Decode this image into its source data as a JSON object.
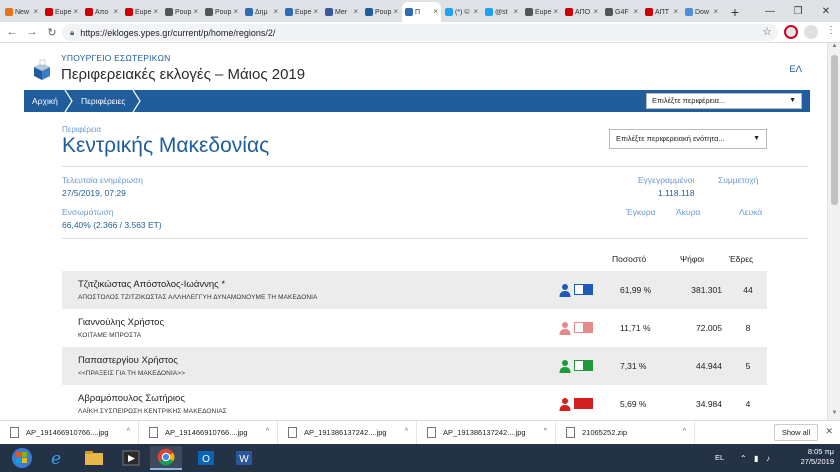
{
  "browser": {
    "tabs": [
      {
        "label": "New",
        "color": "#e8711a",
        "active": false
      },
      {
        "label": "Eupe",
        "color": "#cc0000",
        "active": false
      },
      {
        "label": "Απο",
        "color": "#cc0000",
        "active": false
      },
      {
        "label": "Eupe",
        "color": "#cc0000",
        "active": false
      },
      {
        "label": "Poup",
        "color": "#555555",
        "active": false
      },
      {
        "label": "Poup",
        "color": "#555555",
        "active": false
      },
      {
        "label": "Δημ",
        "color": "#2e6db4",
        "active": false
      },
      {
        "label": "Eupe",
        "color": "#2e6db4",
        "active": false
      },
      {
        "label": "Mer",
        "color": "#3b5998",
        "active": false
      },
      {
        "label": "Poup",
        "color": "#1f5d9c",
        "active": false
      },
      {
        "label": "Π",
        "color": "#2e6db4",
        "active": true
      },
      {
        "label": "(*) ©",
        "color": "#1da1f2",
        "active": false
      },
      {
        "label": "@st",
        "color": "#1da1f2",
        "active": false
      },
      {
        "label": "Eupe",
        "color": "#555555",
        "active": false
      },
      {
        "label": "ΑΠΟ",
        "color": "#cc0000",
        "active": false
      },
      {
        "label": "G4F",
        "color": "#555555",
        "active": false
      },
      {
        "label": "ΑΠΤ",
        "color": "#cc0000",
        "active": false
      },
      {
        "label": "Dow",
        "color": "#4a90d9",
        "active": false
      }
    ],
    "url": "https://ekloges.ypes.gr/current/p/home/regions/2/"
  },
  "site": {
    "ministry": "ΥΠΟΥΡΓΕΙΟ ΕΣΩΤΕΡΙΚΩΝ",
    "title": "Περιφερειακές εκλογές – Μάιος 2019",
    "lang": "ΕΛ",
    "breadcrumb": [
      "Αρχική",
      "Περιφέρειες"
    ],
    "region_select_placeholder": "Επιλέξτε περιφέρεια..."
  },
  "region": {
    "label": "Περιφέρεια",
    "name": "Κεντρικής Μακεδονίας",
    "unit_select_placeholder": "Επιλέξτε περιφερειακή ενότητα..."
  },
  "stats": {
    "last_update_label": "Τελευταία ενημέρωση",
    "last_update_value": "27/5/2019, 07:29",
    "integrated_label": "Ενσωμάτωση",
    "integrated_value": "66,40% (2.366 / 3.563 ΕΤ)",
    "registered_label": "Εγγεγραμμένοι",
    "registered_value": "1.118.118",
    "turnout_label": "Συμμετοχή",
    "valid_label": "Έγκυρα",
    "invalid_label": "Άκυρα",
    "blank_label": "Λευκά"
  },
  "table": {
    "headers": {
      "percent": "Ποσοστό",
      "votes": "Ψήφοι",
      "seats": "Έδρες"
    },
    "rows": [
      {
        "name": "Τζιτζικώστας Απόστολος-Ιωάννης *",
        "party": "ΑΠΟΣΤΟΛΟΣ ΤΖΙΤΖΙΚΩΣΤΑΣ ΑΛΛΗΛΕΓΓΥΗ ΔΥΝΑΜΩΝΟΥΜΕ ΤΗ ΜΑΚΕΔΟΝΙΑ",
        "percent": "61,99 %",
        "votes": "381.301",
        "seats": "44",
        "color": "#1e5bb8",
        "color_light": "#ffffff"
      },
      {
        "name": "Γιαννούλης Χρήστος",
        "party": "ΚΟΙΤΑΜΕ ΜΠΡΟΣΤΑ",
        "percent": "11,71 %",
        "votes": "72.005",
        "seats": "8",
        "color": "#e88a8a",
        "color_light": "#ffffff"
      },
      {
        "name": "Παπαστεργίου Χρήστος",
        "party": "<<ΠΡΑΞΕΙΣ ΓΙΑ ΤΗ ΜΑΚΕΔΟΝΙΑ>>",
        "percent": "7,31 %",
        "votes": "44.944",
        "seats": "5",
        "color": "#1c9a3c",
        "color_light": "#ffffff"
      },
      {
        "name": "Αβραμόπουλος Σωτήριος",
        "party": "ΛΑΪΚΗ ΣΥΣΠΕΙΡΩΣΗ ΚΕΝΤΡΙΚΗΣ ΜΑΚΕΔΟΝΙΑΣ",
        "percent": "5,69 %",
        "votes": "34.984",
        "seats": "4",
        "color": "#d31f1f",
        "color_light": "#d31f1f"
      }
    ]
  },
  "downloads": {
    "items": [
      "AP_191466910766....jpg",
      "AP_191466910766....jpg",
      "AP_191386137242....jpg",
      "AP_191386137242....jpg",
      "21065252.zip"
    ],
    "show_all": "Show all"
  },
  "taskbar": {
    "lang": "EL",
    "time": "8:05 πμ",
    "date": "27/5/2019"
  }
}
